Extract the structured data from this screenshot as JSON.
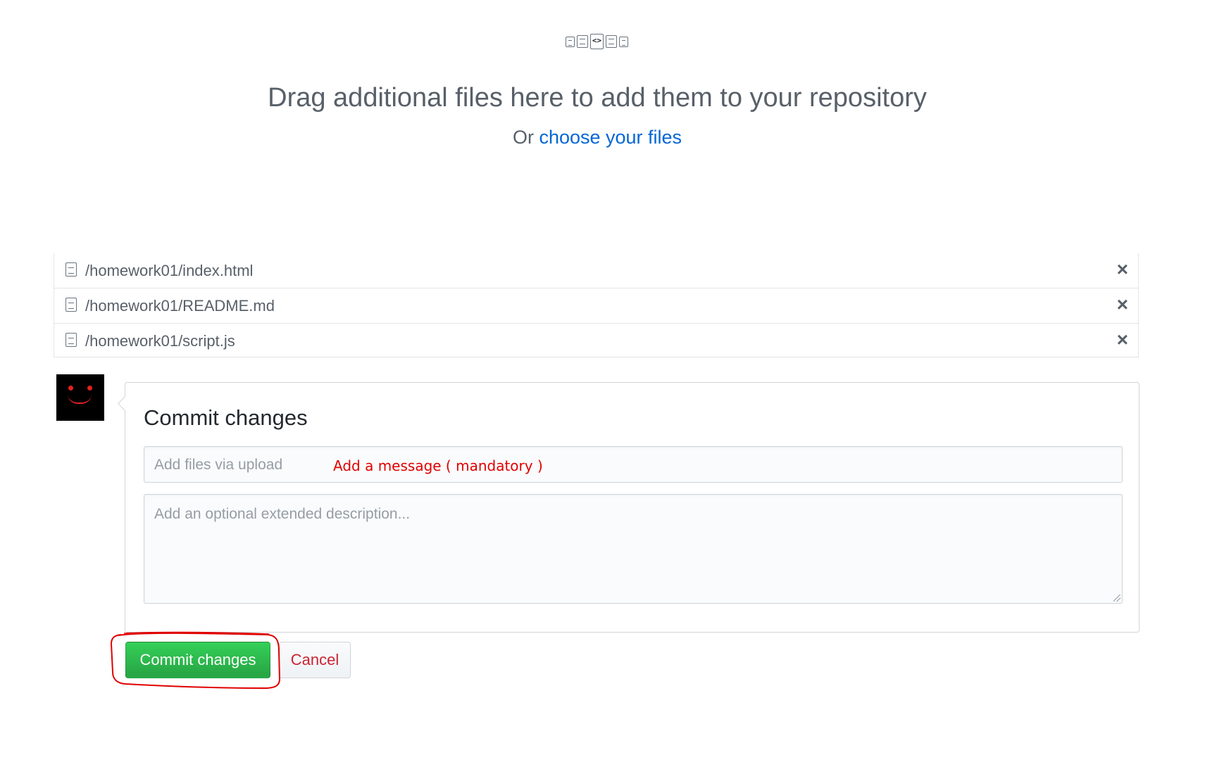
{
  "dropzone": {
    "title": "Drag additional files here to add them to your repository",
    "or_text": "Or",
    "choose_link": "choose your files",
    "file_type_icons": [
      "file-text-icon",
      "file-chart-icon",
      "file-code-icon",
      "file-document-icon",
      "file-pdf-icon"
    ]
  },
  "files": [
    {
      "path": "/homework01/index.html",
      "remove_icon": "×"
    },
    {
      "path": "/homework01/README.md",
      "remove_icon": "×"
    },
    {
      "path": "/homework01/script.js",
      "remove_icon": "×"
    }
  ],
  "commit": {
    "heading": "Commit changes",
    "message_placeholder": "Add files via upload",
    "annotation": "Add a message ( mandatory )",
    "description_placeholder": "Add an optional extended description...",
    "commit_button": "Commit changes",
    "cancel_button": "Cancel"
  },
  "colors": {
    "link": "#0366d6",
    "commit_button": "#28a745",
    "cancel_text": "#cb2431",
    "annotation": "#e00000"
  }
}
